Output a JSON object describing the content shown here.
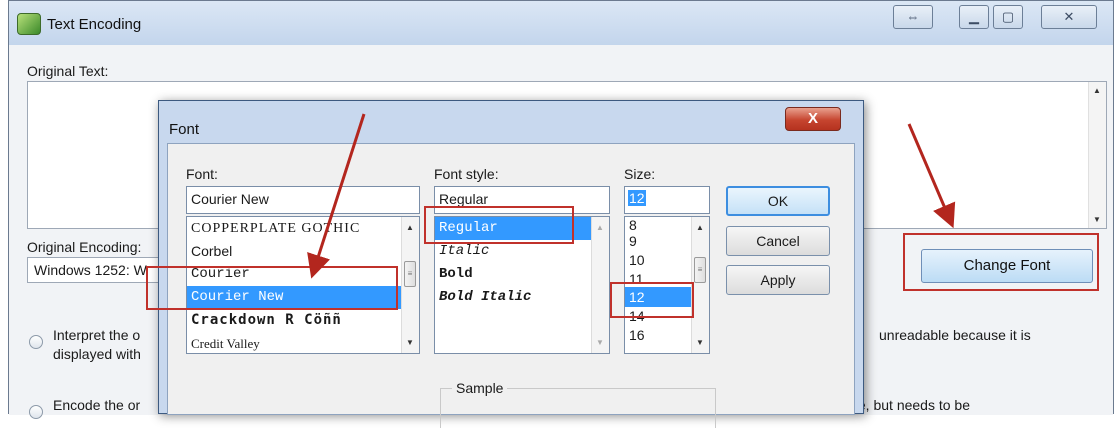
{
  "window": {
    "title": "Text Encoding",
    "controls": {
      "restore": "⇔",
      "minimize": "▁",
      "maximize": "▢",
      "close": "✕"
    }
  },
  "main": {
    "original_text_label": "Original Text:",
    "original_encoding_label": "Original Encoding:",
    "encoding_value": "Windows 1252: W",
    "change_font_label": "Change Font",
    "option1_line1": "Interpret the o",
    "option1_line2": "displayed with",
    "option1_right": "unreadable because it is",
    "option2_line1": "Encode the or",
    "option2_right": "ble, but needs to be"
  },
  "dialog": {
    "title": "Font",
    "close_label": "X",
    "font_label": "Font:",
    "font_value": "Courier New",
    "style_label": "Font style:",
    "style_value": "Regular",
    "size_label": "Size:",
    "size_value": "12",
    "fonts": [
      "COPPERPLATE GOTHIC",
      "Corbel",
      "Courier",
      "Courier New",
      "Crackdown R Cöññ",
      "Credit Valley"
    ],
    "styles": [
      "Regular",
      "Italic",
      "Bold",
      "Bold Italic"
    ],
    "sizes": [
      "8",
      "9",
      "10",
      "11",
      "12",
      "14",
      "16"
    ],
    "ok_label": "OK",
    "cancel_label": "Cancel",
    "apply_label": "Apply",
    "sample_label": "Sample"
  },
  "colors": {
    "annotation_red": "#c0312b",
    "selection_blue": "#3399ff"
  }
}
